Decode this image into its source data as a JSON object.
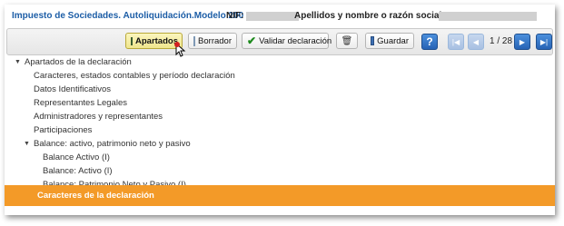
{
  "header": {
    "title": "Impuesto de Sociedades. Autoliquidación.Modelo 200",
    "nif_label": "NIF:",
    "name_label": "Apellidos y nombre o razón social:"
  },
  "toolbar": {
    "apartados": "Apartados",
    "borrador": "Borrador",
    "validar": "Validar declaración",
    "guardar": "Guardar",
    "help": "?",
    "page_indicator": "1 / 28"
  },
  "tree": {
    "root": "Apartados de la declaración",
    "items": [
      "Caracteres, estados contables y período declaración",
      "Datos Identificativos",
      "Representantes Legales",
      "Administradores y representantes",
      "Participaciones"
    ],
    "balance": {
      "label": "Balance: activo, patrimonio neto y pasivo",
      "children": [
        "Balance Activo (I)",
        "Balance: Activo (I)",
        "Balance: Patrimonio Neto y Pasivo (I)"
      ]
    }
  },
  "footer": {
    "section_title": "Caracteres de la declaración"
  },
  "colors": {
    "title_blue": "#1c5da6",
    "footer_orange": "#f39a28",
    "apartados_active": "#efe68d"
  }
}
